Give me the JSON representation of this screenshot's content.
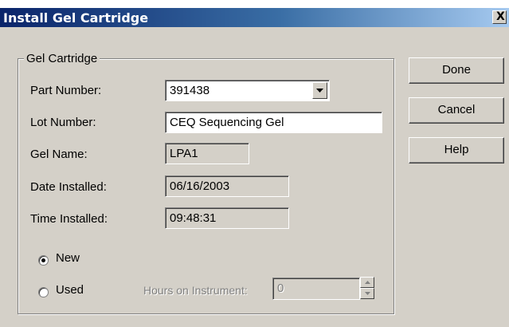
{
  "window": {
    "title": "Install Gel Cartridge",
    "close_glyph": "X"
  },
  "group": {
    "legend": "Gel Cartridge"
  },
  "fields": {
    "part_number": {
      "label": "Part Number:",
      "value": "391438"
    },
    "lot_number": {
      "label": "Lot Number:",
      "value": "CEQ Sequencing Gel"
    },
    "gel_name": {
      "label": "Gel Name:",
      "value": "LPA1"
    },
    "date_installed": {
      "label": "Date Installed:",
      "value": "06/16/2003"
    },
    "time_installed": {
      "label": "Time Installed:",
      "value": "09:48:31"
    }
  },
  "status": {
    "new_label": "New",
    "used_label": "Used",
    "selected": "New"
  },
  "hours": {
    "label": "Hours on Instrument:",
    "value": "0"
  },
  "buttons": {
    "done": "Done",
    "cancel": "Cancel",
    "help": "Help"
  },
  "icons": {
    "dropdown": "chevron-down-icon",
    "spin_up": "arrow-up-icon",
    "spin_down": "arrow-down-icon"
  }
}
